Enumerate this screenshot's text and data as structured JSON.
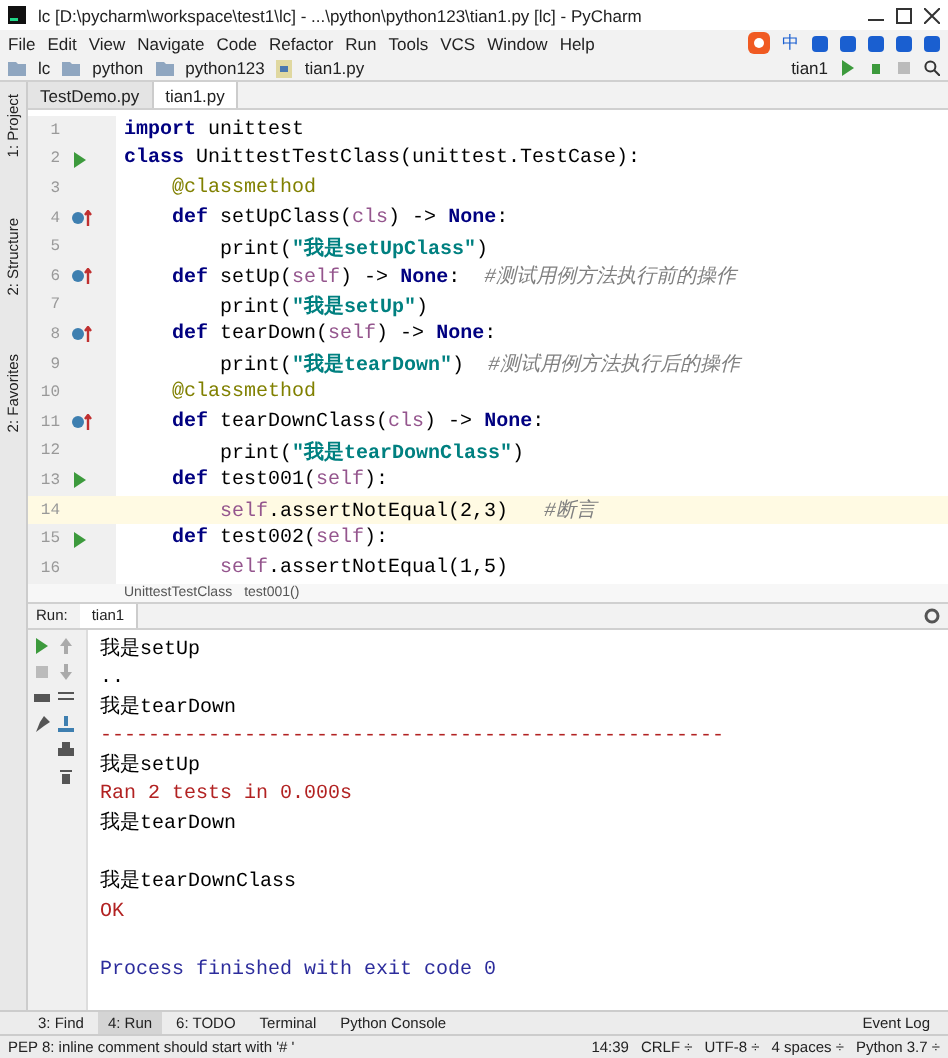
{
  "window": {
    "title": "lc [D:\\pycharm\\workspace\\test1\\lc] - ...\\python\\python123\\tian1.py [lc] - PyCharm"
  },
  "ime_toolbar": {
    "label": "中"
  },
  "menu": [
    "File",
    "Edit",
    "View",
    "Navigate",
    "Code",
    "Refactor",
    "Run",
    "Tools",
    "VCS",
    "Window",
    "Help"
  ],
  "nav_path": [
    "lc",
    "python",
    "python123",
    "tian1.py"
  ],
  "run_config": "tian1",
  "editor_tabs": [
    {
      "label": "TestDemo.py",
      "selected": false
    },
    {
      "label": "tian1.py",
      "selected": true
    }
  ],
  "side_tools": [
    "1: Project",
    "2: Structure",
    "2: Favorites"
  ],
  "code": [
    {
      "number": "1",
      "run_marker": false,
      "override_marker": false,
      "current": false,
      "tokens": [
        {
          "kind": "kw",
          "text": "import"
        },
        {
          "kind": "plain",
          "text": " unittest"
        }
      ]
    },
    {
      "number": "2",
      "run_marker": true,
      "override_marker": false,
      "current": false,
      "tokens": [
        {
          "kind": "kw",
          "text": "class"
        },
        {
          "kind": "plain",
          "text": " UnittestTestClass(unittest.TestCase):"
        }
      ],
      "children": [
        {
          "number": "3",
          "run_marker": false,
          "override_marker": false,
          "current": false,
          "tokens": [
            {
              "kind": "deco",
              "text": "@classmethod"
            }
          ]
        },
        {
          "number": "4",
          "run_marker": false,
          "override_marker": true,
          "current": false,
          "tokens": [
            {
              "kind": "kw",
              "text": "def"
            },
            {
              "kind": "plain",
              "text": " setUpClass("
            },
            {
              "kind": "self",
              "text": "cls"
            },
            {
              "kind": "plain",
              "text": ") -> "
            },
            {
              "kind": "kw",
              "text": "None"
            },
            {
              "kind": "plain",
              "text": ":"
            }
          ],
          "children": [
            {
              "number": "5",
              "run_marker": false,
              "override_marker": false,
              "current": false,
              "tokens": [
                {
                  "kind": "plain",
                  "text": "print("
                },
                {
                  "kind": "str",
                  "text": "\"我是setUpClass\""
                },
                {
                  "kind": "plain",
                  "text": ")"
                }
              ]
            }
          ]
        },
        {
          "number": "6",
          "run_marker": false,
          "override_marker": true,
          "current": false,
          "tokens": [
            {
              "kind": "kw",
              "text": "def"
            },
            {
              "kind": "plain",
              "text": " setUp("
            },
            {
              "kind": "self",
              "text": "self"
            },
            {
              "kind": "plain",
              "text": ") -> "
            },
            {
              "kind": "kw",
              "text": "None"
            },
            {
              "kind": "plain",
              "text": ":  "
            },
            {
              "kind": "comment",
              "text": "#测试用例方法执行前的操作"
            }
          ],
          "children": [
            {
              "number": "7",
              "run_marker": false,
              "override_marker": false,
              "current": false,
              "tokens": [
                {
                  "kind": "plain",
                  "text": "print("
                },
                {
                  "kind": "str",
                  "text": "\"我是setUp\""
                },
                {
                  "kind": "plain",
                  "text": ")"
                }
              ]
            }
          ]
        },
        {
          "number": "8",
          "run_marker": false,
          "override_marker": true,
          "current": false,
          "tokens": [
            {
              "kind": "kw",
              "text": "def"
            },
            {
              "kind": "plain",
              "text": " tearDown("
            },
            {
              "kind": "self",
              "text": "self"
            },
            {
              "kind": "plain",
              "text": ") -> "
            },
            {
              "kind": "kw",
              "text": "None"
            },
            {
              "kind": "plain",
              "text": ":"
            }
          ],
          "children": [
            {
              "number": "9",
              "run_marker": false,
              "override_marker": false,
              "current": false,
              "tokens": [
                {
                  "kind": "plain",
                  "text": "print("
                },
                {
                  "kind": "str",
                  "text": "\"我是tearDown\""
                },
                {
                  "kind": "plain",
                  "text": ")  "
                },
                {
                  "kind": "comment",
                  "text": "#测试用例方法执行后的操作"
                }
              ]
            }
          ]
        },
        {
          "number": "10",
          "run_marker": false,
          "override_marker": false,
          "current": false,
          "tokens": [
            {
              "kind": "deco",
              "text": "@classmethod"
            }
          ]
        },
        {
          "number": "11",
          "run_marker": false,
          "override_marker": true,
          "current": false,
          "tokens": [
            {
              "kind": "kw",
              "text": "def"
            },
            {
              "kind": "plain",
              "text": " tearDownClass("
            },
            {
              "kind": "self",
              "text": "cls"
            },
            {
              "kind": "plain",
              "text": ") -> "
            },
            {
              "kind": "kw",
              "text": "None"
            },
            {
              "kind": "plain",
              "text": ":"
            }
          ],
          "children": [
            {
              "number": "12",
              "run_marker": false,
              "override_marker": false,
              "current": false,
              "tokens": [
                {
                  "kind": "plain",
                  "text": "print("
                },
                {
                  "kind": "str",
                  "text": "\"我是tearDownClass\""
                },
                {
                  "kind": "plain",
                  "text": ")"
                }
              ]
            }
          ]
        },
        {
          "number": "13",
          "run_marker": true,
          "override_marker": false,
          "current": false,
          "tokens": [
            {
              "kind": "kw",
              "text": "def"
            },
            {
              "kind": "plain",
              "text": " test001("
            },
            {
              "kind": "self",
              "text": "self"
            },
            {
              "kind": "plain",
              "text": "):"
            }
          ],
          "children": [
            {
              "number": "14",
              "run_marker": false,
              "override_marker": false,
              "current": true,
              "tokens": [
                {
                  "kind": "self",
                  "text": "self"
                },
                {
                  "kind": "plain",
                  "text": ".assertNotEqual(2,3)   "
                },
                {
                  "kind": "comment",
                  "text": "#断言"
                }
              ]
            }
          ]
        },
        {
          "number": "15",
          "run_marker": true,
          "override_marker": false,
          "current": false,
          "tokens": [
            {
              "kind": "kw",
              "text": "def"
            },
            {
              "kind": "plain",
              "text": " test002("
            },
            {
              "kind": "self",
              "text": "self"
            },
            {
              "kind": "plain",
              "text": "):"
            }
          ],
          "children": [
            {
              "number": "16",
              "run_marker": false,
              "override_marker": false,
              "current": false,
              "tokens": [
                {
                  "kind": "self",
                  "text": "self"
                },
                {
                  "kind": "plain",
                  "text": ".assertNotEqual(1,5)"
                }
              ]
            }
          ]
        }
      ]
    }
  ],
  "editor_breadcrumb": [
    "UnittestTestClass",
    "test001()"
  ],
  "run_panel": {
    "label": "Run:",
    "tab": "tian1"
  },
  "console": [
    {
      "kind": "out",
      "text": "我是setUp"
    },
    {
      "kind": "out",
      "text": ".."
    },
    {
      "kind": "out",
      "text": "我是tearDown"
    },
    {
      "kind": "err",
      "text": "----------------------------------------------------"
    },
    {
      "kind": "out",
      "text": "我是setUp"
    },
    {
      "kind": "err",
      "text": "Ran 2 tests in 0.000s"
    },
    {
      "kind": "out",
      "text": "我是tearDown"
    },
    {
      "kind": "blank"
    },
    {
      "kind": "out",
      "text": "我是tearDownClass"
    },
    {
      "kind": "err",
      "text": "OK"
    },
    {
      "kind": "blank"
    },
    {
      "kind": "sys",
      "text": "Process finished with exit code 0"
    }
  ],
  "tool_windows": [
    {
      "label": "3: Find",
      "selected": false
    },
    {
      "label": "4: Run",
      "selected": true
    },
    {
      "label": "6: TODO",
      "selected": false
    },
    {
      "label": "Terminal",
      "selected": false
    },
    {
      "label": "Python Console",
      "selected": false
    }
  ],
  "event_log": "Event Log",
  "status_bar": {
    "message": "PEP 8: inline comment should start with '# '",
    "items": [
      "14:39",
      "CRLF ÷",
      "UTF-8 ÷",
      "4 spaces ÷",
      "Python 3.7 ÷"
    ]
  }
}
